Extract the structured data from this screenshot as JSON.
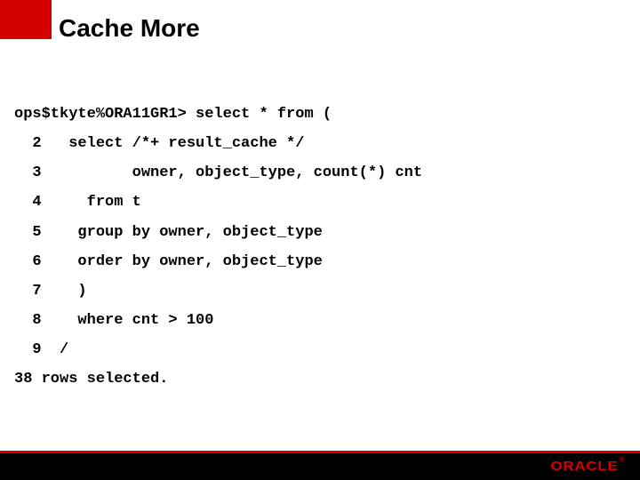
{
  "title": "Cache More",
  "code": {
    "l0": "ops$tkyte%ORA11GR1> select * from (",
    "l1": "  2   select /*+ result_cache */",
    "l2": "  3          owner, object_type, count(*) cnt",
    "l3": "  4     from t",
    "l4": "  5    group by owner, object_type",
    "l5": "  6    order by owner, object_type",
    "l6": "  7    )",
    "l7": "  8    where cnt > 100",
    "l8": "  9  /",
    "l9": "38 rows selected."
  },
  "logo": "ORACLE",
  "logo_suffix": "®"
}
